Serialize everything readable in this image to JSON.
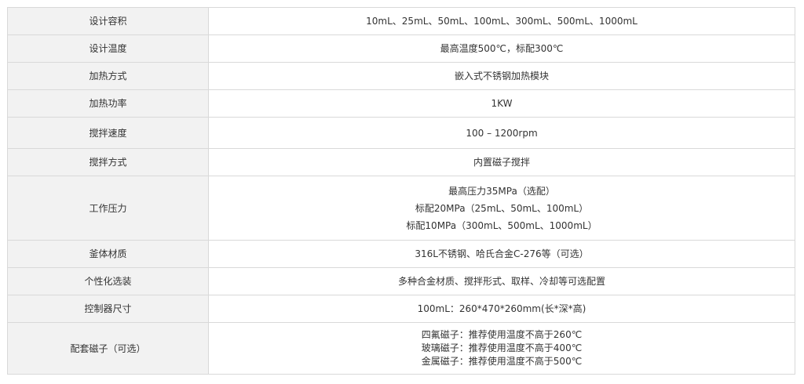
{
  "rows": [
    {
      "label": "设计容积",
      "lines": [
        "10mL、25mL、50mL、100mL、300mL、500mL、1000mL"
      ]
    },
    {
      "label": "设计温度",
      "lines": [
        "最高温度500℃，标配300℃"
      ]
    },
    {
      "label": "加热方式",
      "lines": [
        "嵌入式不锈钢加热模块"
      ]
    },
    {
      "label": "加热功率",
      "lines": [
        "1KW"
      ]
    },
    {
      "label": "搅拌速度",
      "lines": [
        "100 – 1200rpm"
      ]
    },
    {
      "label": "搅拌方式",
      "lines": [
        "内置磁子搅拌"
      ]
    },
    {
      "label": "工作压力",
      "lines": [
        "最高压力35MPa（选配）",
        "标配20MPa（25mL、50mL、100mL）",
        "标配10MPa（300mL、500mL、1000mL）"
      ]
    },
    {
      "label": "釜体材质",
      "lines": [
        "316L不锈钢、哈氏合金C-276等（可选）"
      ]
    },
    {
      "label": "个性化选装",
      "lines": [
        "多种合金材质、搅拌形式、取样、冷却等可选配置"
      ]
    },
    {
      "label": "控制器尺寸",
      "lines": [
        "100mL：260*470*260mm(长*深*高)"
      ]
    },
    {
      "label": "配套磁子（可选）",
      "lines": [
        "四氟磁子：推荐使用温度不高于260℃",
        "玻璃磁子：推荐使用温度不高于400℃",
        "金属磁子：推荐使用温度不高于500℃"
      ]
    }
  ]
}
